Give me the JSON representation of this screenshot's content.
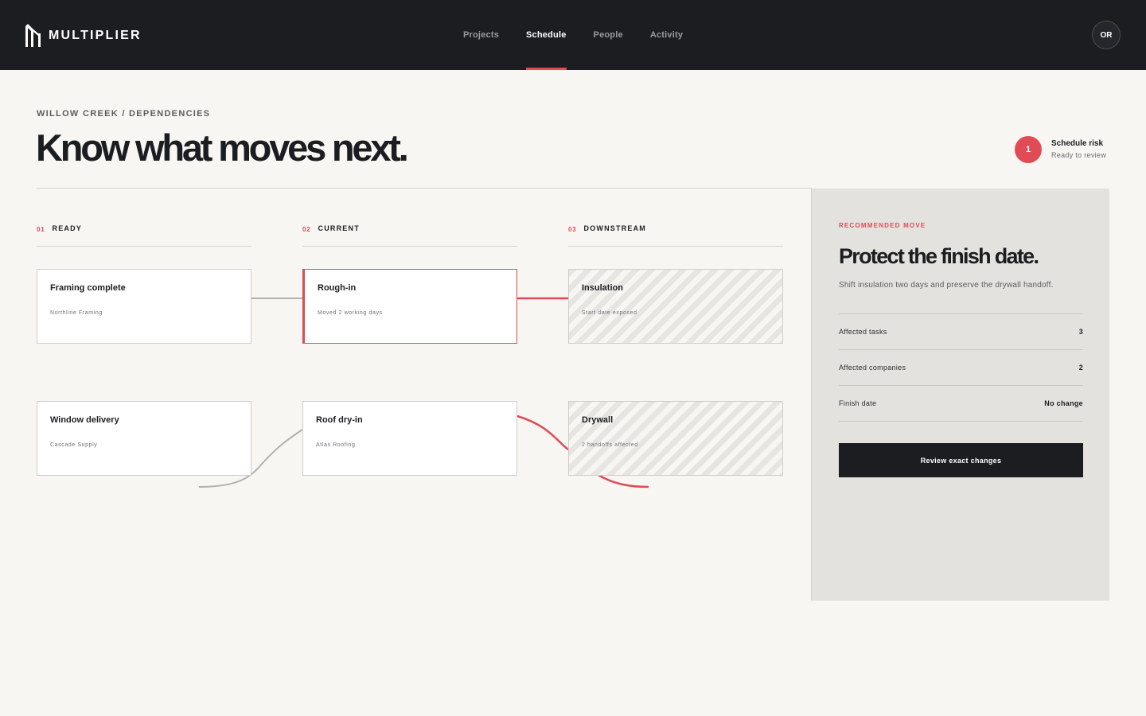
{
  "app": {
    "name": "MULTIPLIER"
  },
  "nav": {
    "tabs": [
      {
        "label": "Projects",
        "active": false
      },
      {
        "label": "Schedule",
        "active": true
      },
      {
        "label": "People",
        "active": false
      },
      {
        "label": "Activity",
        "active": false
      }
    ],
    "avatar_initials": "OR"
  },
  "page": {
    "breadcrumb": "WILLOW CREEK / DEPENDENCIES",
    "title": "Know what moves next."
  },
  "risk": {
    "count": "1",
    "title": "Schedule risk",
    "subtitle": "Ready to review"
  },
  "columns": [
    {
      "num": "01",
      "label": "READY"
    },
    {
      "num": "02",
      "label": "CURRENT"
    },
    {
      "num": "03",
      "label": "DOWNSTREAM"
    }
  ],
  "cards": {
    "framing": {
      "title": "Framing complete",
      "meta": "Northline Framing"
    },
    "rough_in": {
      "title": "Rough-in",
      "meta": "Moved 2 working days"
    },
    "insulation": {
      "title": "Insulation",
      "meta": "Start date exposed"
    },
    "window": {
      "title": "Window delivery",
      "meta": "Cascade Supply"
    },
    "roof": {
      "title": "Roof dry-in",
      "meta": "Atlas Roofing"
    },
    "drywall": {
      "title": "Drywall",
      "meta": "2 handoffs affected"
    }
  },
  "panel": {
    "eyebrow": "RECOMMENDED MOVE",
    "title": "Protect the finish date.",
    "description": "Shift insulation two days and preserve the drywall handoff.",
    "stats": [
      {
        "label": "Affected tasks",
        "value": "3"
      },
      {
        "label": "Affected companies",
        "value": "2"
      },
      {
        "label": "Finish date",
        "value": "No change"
      }
    ],
    "cta_label": "Review exact changes"
  },
  "colors": {
    "accent": "#e04b55",
    "ink": "#1b1d21",
    "background": "#f7f6f3",
    "panel": "#e3e2de"
  },
  "icons": {
    "logo": "multiplier-logo-icon"
  }
}
